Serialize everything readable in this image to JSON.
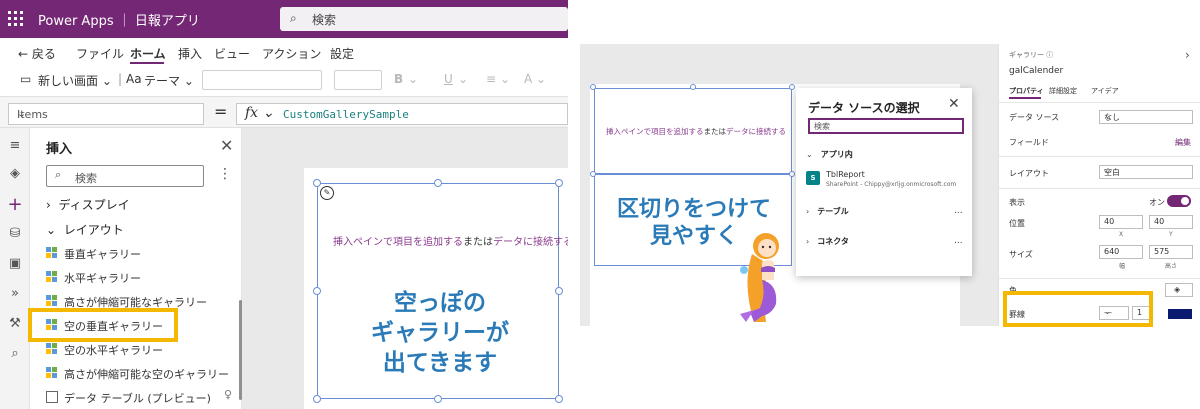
{
  "app": {
    "title": "Power Apps ｜ 日報アプリ",
    "search_placeholder": "検索"
  },
  "menu": {
    "back": "← 戻る",
    "items": [
      "ファイル",
      "ホーム",
      "挿入",
      "ビュー",
      "アクション",
      "設定"
    ],
    "active": "ホーム"
  },
  "toolbar": {
    "new_screen": "新しい画面",
    "theme": "テーマ",
    "bold": "B",
    "underline": "U",
    "font_size": "A"
  },
  "formula": {
    "property": "Items",
    "equals": "=",
    "fx": "fx",
    "value": "CustomGallerySample"
  },
  "insert_pane": {
    "title": "挿入",
    "search_placeholder": "検索",
    "sections": [
      {
        "label": "ディスプレイ",
        "expanded": false
      },
      {
        "label": "レイアウト",
        "expanded": true
      }
    ],
    "items": [
      "垂直ギャラリー",
      "水平ギャラリー",
      "高さが伸縮可能なギャラリー",
      "空の垂直ギャラリー",
      "空の水平ギャラリー",
      "高さが伸縮可能な空のギャラリー",
      "データ テーブル (プレビュー)"
    ],
    "selected": "空の垂直ギャラリー"
  },
  "canvas_left": {
    "hint_parts": [
      "挿入ペインで項目を追加する",
      "または",
      "データに接続する"
    ],
    "annotation": [
      "空っぽの",
      "ギャラリーが",
      "出てきます"
    ]
  },
  "canvas_right": {
    "hint_parts": [
      "挿入ペインで項目を追加する",
      "または",
      "データに接続する"
    ],
    "annotation": [
      "区切りをつけて",
      "見やすく"
    ]
  },
  "data_source": {
    "title": "データ ソースの選択",
    "search_placeholder": "検索",
    "in_app": "アプリ内",
    "table_name": "TblReport",
    "table_sub": "SharePoint - Chippy@xrljg.onmicrosoft.com",
    "tables": "テーブル",
    "connectors": "コネクタ",
    "more": "..."
  },
  "properties": {
    "header": "ギャラリー",
    "control_name": "galCalender",
    "tabs": [
      "プロパティ",
      "詳細設定",
      "アイデア"
    ],
    "data_source_label": "データ ソース",
    "data_source_value": "なし",
    "fields_label": "フィールド",
    "fields_action": "編集",
    "layout_label": "レイアウト",
    "layout_value": "空白",
    "visible_label": "表示",
    "visible_value": "オン",
    "position_label": "位置",
    "position_x": "40",
    "position_y": "40",
    "x_label": "X",
    "y_label": "Y",
    "size_label": "サイズ",
    "width": "640",
    "height": "575",
    "width_label": "幅",
    "height_label": "高さ",
    "color_label": "色",
    "border_label": "罫線",
    "border_style": "—",
    "border_width": "1",
    "border_color": "#0a1a6e"
  },
  "colors": {
    "brand": "#742774",
    "highlight": "#f5b800",
    "annotation": "#2a7ab8"
  }
}
